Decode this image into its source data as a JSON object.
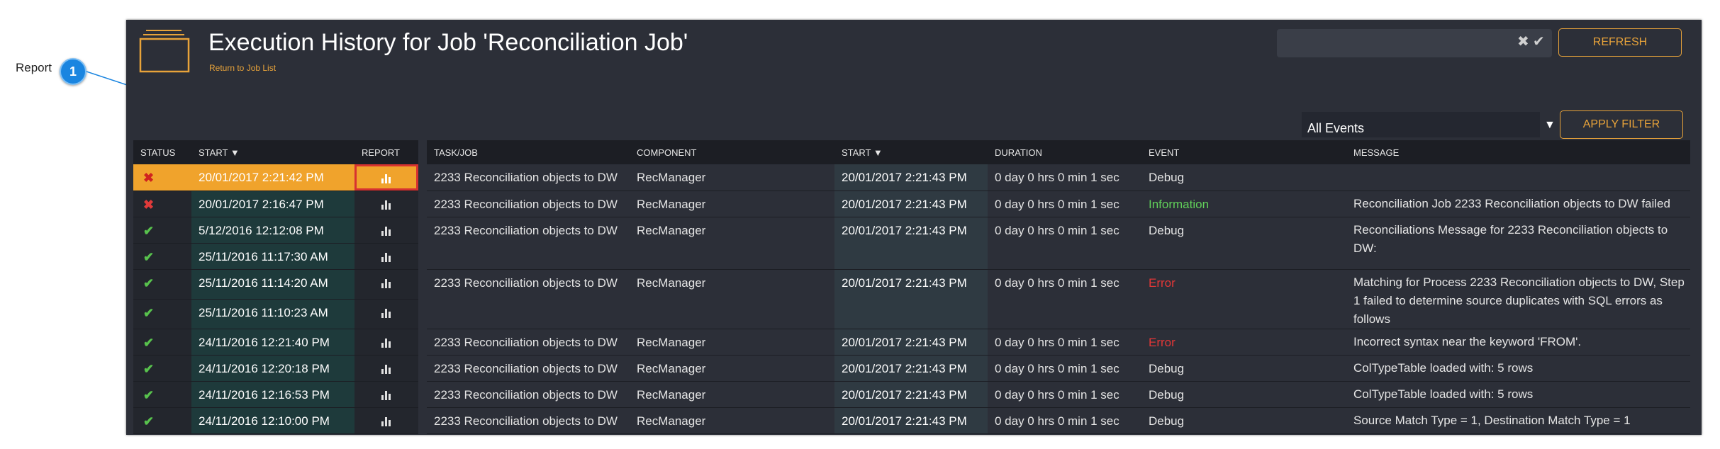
{
  "annotation": {
    "label": "Report",
    "badge": "1"
  },
  "header": {
    "title": "Execution History for Job 'Reconciliation Job'",
    "back_link": "Return to Job List"
  },
  "search": {
    "value": "",
    "clear_icon": "close-icon",
    "confirm_icon": "check-icon"
  },
  "buttons": {
    "refresh": "REFRESH",
    "apply_filter": "APPLY FILTER"
  },
  "filter": {
    "selected": "All Events"
  },
  "colors": {
    "accent": "#e8a33a",
    "error": "#e23737",
    "ok": "#58c24d",
    "info": "#61d05a",
    "panel": "#2c2f38"
  },
  "runs_table": {
    "headers": {
      "status": "STATUS",
      "start": "START",
      "report": "REPORT"
    },
    "rows": [
      {
        "status": "fail",
        "start": "20/01/2017 2:21:42 PM"
      },
      {
        "status": "fail",
        "start": "20/01/2017 2:16:47 PM"
      },
      {
        "status": "ok",
        "start": "5/12/2016 12:12:08 PM"
      },
      {
        "status": "ok",
        "start": "25/11/2016 11:17:30 AM"
      },
      {
        "status": "ok",
        "start": "25/11/2016 11:14:20 AM"
      },
      {
        "status": "ok",
        "start": "25/11/2016 11:10:23 AM"
      },
      {
        "status": "ok",
        "start": "24/11/2016 12:21:40 PM"
      },
      {
        "status": "ok",
        "start": "24/11/2016 12:20:18 PM"
      },
      {
        "status": "ok",
        "start": "24/11/2016 12:16:53 PM"
      },
      {
        "status": "ok",
        "start": "24/11/2016 12:10:00 PM"
      }
    ]
  },
  "events_table": {
    "headers": {
      "task": "TASK/JOB",
      "component": "COMPONENT",
      "start": "START",
      "duration": "DURATION",
      "event": "EVENT",
      "message": "MESSAGE"
    },
    "rows": [
      {
        "task": "2233 Reconciliation objects to DW",
        "component": "RecManager",
        "start": "20/01/2017 2:21:43 PM",
        "duration": "0 day 0 hrs 0 min 1 sec",
        "event": "Debug",
        "message": ""
      },
      {
        "task": "2233 Reconciliation objects to DW",
        "component": "RecManager",
        "start": "20/01/2017 2:21:43 PM",
        "duration": "0 day 0 hrs 0 min 1 sec",
        "event": "Information",
        "message": "Reconciliation Job 2233 Reconciliation objects to DW failed"
      },
      {
        "task": "2233 Reconciliation objects to DW",
        "component": "RecManager",
        "start": "20/01/2017 2:21:43 PM",
        "duration": "0 day 0 hrs 0 min 1 sec",
        "event": "Debug",
        "message": "Reconciliations Message for 2233 Reconciliation objects to DW:"
      },
      {
        "task": "2233 Reconciliation objects to DW",
        "component": "RecManager",
        "start": "20/01/2017 2:21:43 PM",
        "duration": "0 day 0 hrs 0 min 1 sec",
        "event": "Error",
        "message": "Matching for Process 2233 Reconciliation objects to DW, Step 1 failed to determine source duplicates with SQL errors as follows"
      },
      {
        "task": "2233 Reconciliation objects to DW",
        "component": "RecManager",
        "start": "20/01/2017 2:21:43 PM",
        "duration": "0 day 0 hrs 0 min 1 sec",
        "event": "Error",
        "message": "Incorrect syntax near the keyword 'FROM'."
      },
      {
        "task": "2233 Reconciliation objects to DW",
        "component": "RecManager",
        "start": "20/01/2017 2:21:43 PM",
        "duration": "0 day 0 hrs 0 min 1 sec",
        "event": "Debug",
        "message": "ColTypeTable loaded with: 5 rows"
      },
      {
        "task": "2233 Reconciliation objects to DW",
        "component": "RecManager",
        "start": "20/01/2017 2:21:43 PM",
        "duration": "0 day 0 hrs 0 min 1 sec",
        "event": "Debug",
        "message": "ColTypeTable loaded with: 5 rows"
      },
      {
        "task": "2233 Reconciliation objects to DW",
        "component": "RecManager",
        "start": "20/01/2017 2:21:43 PM",
        "duration": "0 day 0 hrs 0 min 1 sec",
        "event": "Debug",
        "message": "Source Match Type = 1, Destination Match Type = 1"
      }
    ]
  }
}
